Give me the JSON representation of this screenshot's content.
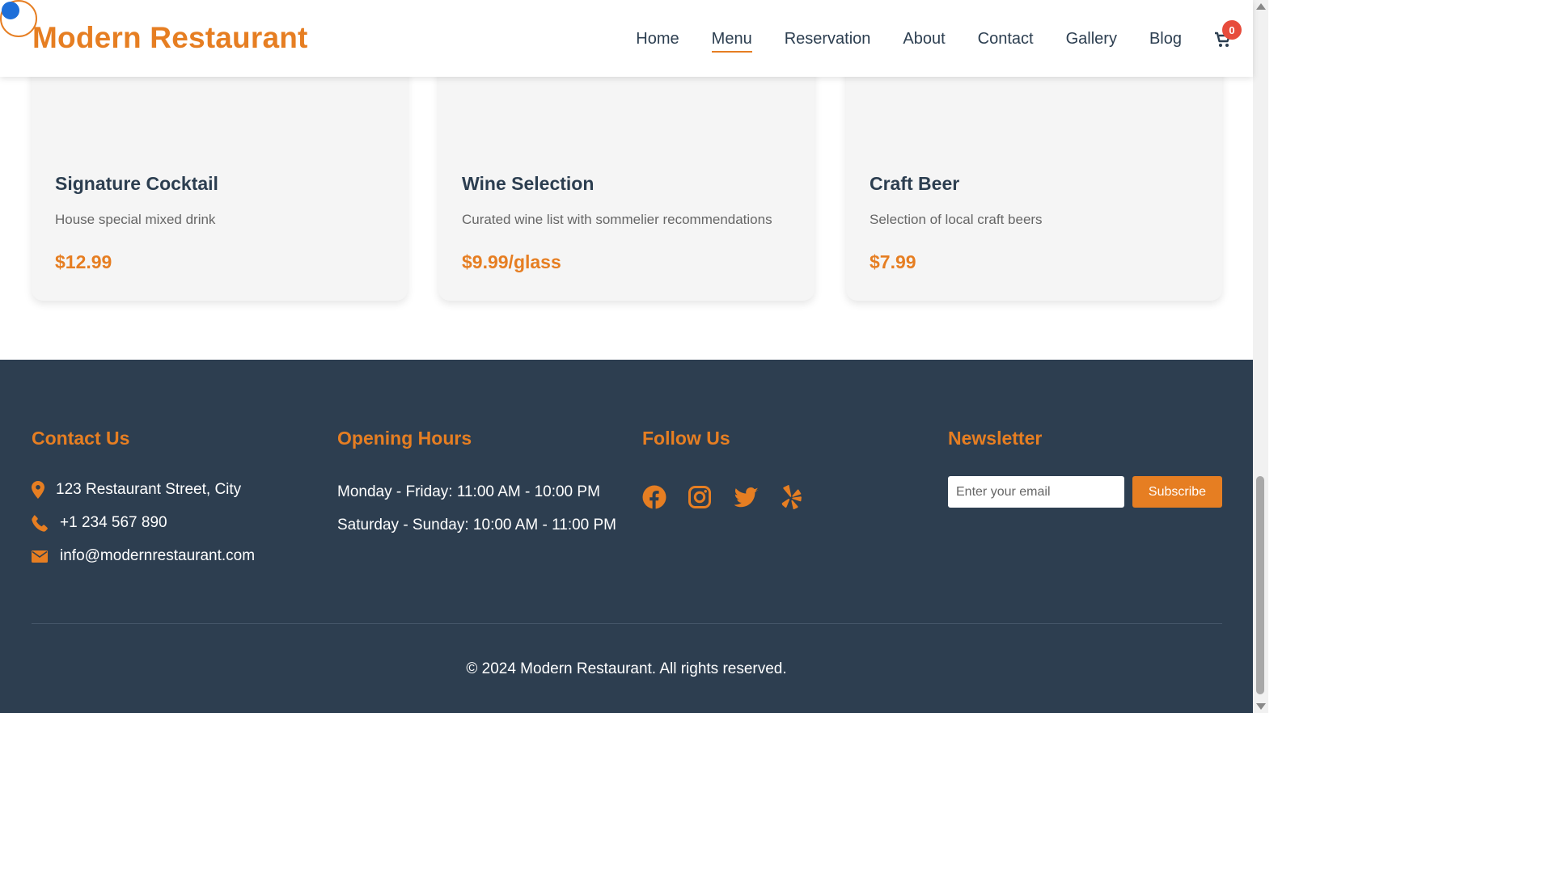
{
  "header": {
    "brand": "Modern Restaurant",
    "nav": [
      {
        "label": "Home"
      },
      {
        "label": "Menu",
        "active": true
      },
      {
        "label": "Reservation"
      },
      {
        "label": "About"
      },
      {
        "label": "Contact"
      },
      {
        "label": "Gallery"
      },
      {
        "label": "Blog"
      }
    ],
    "cart_count": "0",
    "cart_icon": "shopping-cart-icon"
  },
  "menu_cards": [
    {
      "title": "Signature Cocktail",
      "description": "House special mixed drink",
      "price": "$12.99"
    },
    {
      "title": "Wine Selection",
      "description": "Curated wine list with sommelier recommendations",
      "price": "$9.99/glass"
    },
    {
      "title": "Craft Beer",
      "description": "Selection of local craft beers",
      "price": "$7.99"
    }
  ],
  "footer": {
    "contact": {
      "title": "Contact Us",
      "address": "123 Restaurant Street, City",
      "phone": "+1 234 567 890",
      "email": "info@modernrestaurant.com"
    },
    "hours": {
      "title": "Opening Hours",
      "weekdays": "Monday - Friday: 11:00 AM - 10:00 PM",
      "weekend": "Saturday - Sunday: 10:00 AM - 11:00 PM"
    },
    "social": {
      "title": "Follow Us",
      "icons": [
        "facebook-icon",
        "instagram-icon",
        "twitter-icon",
        "yelp-icon"
      ]
    },
    "newsletter": {
      "title": "Newsletter",
      "placeholder": "Enter your email",
      "value": "",
      "button": "Subscribe"
    },
    "copyright": "© 2024 Modern Restaurant. All rights reserved."
  },
  "colors": {
    "accent": "#e67e22",
    "footer_bg": "#2d3e50",
    "badge": "#e74c3c",
    "heading": "#2c3e50"
  }
}
